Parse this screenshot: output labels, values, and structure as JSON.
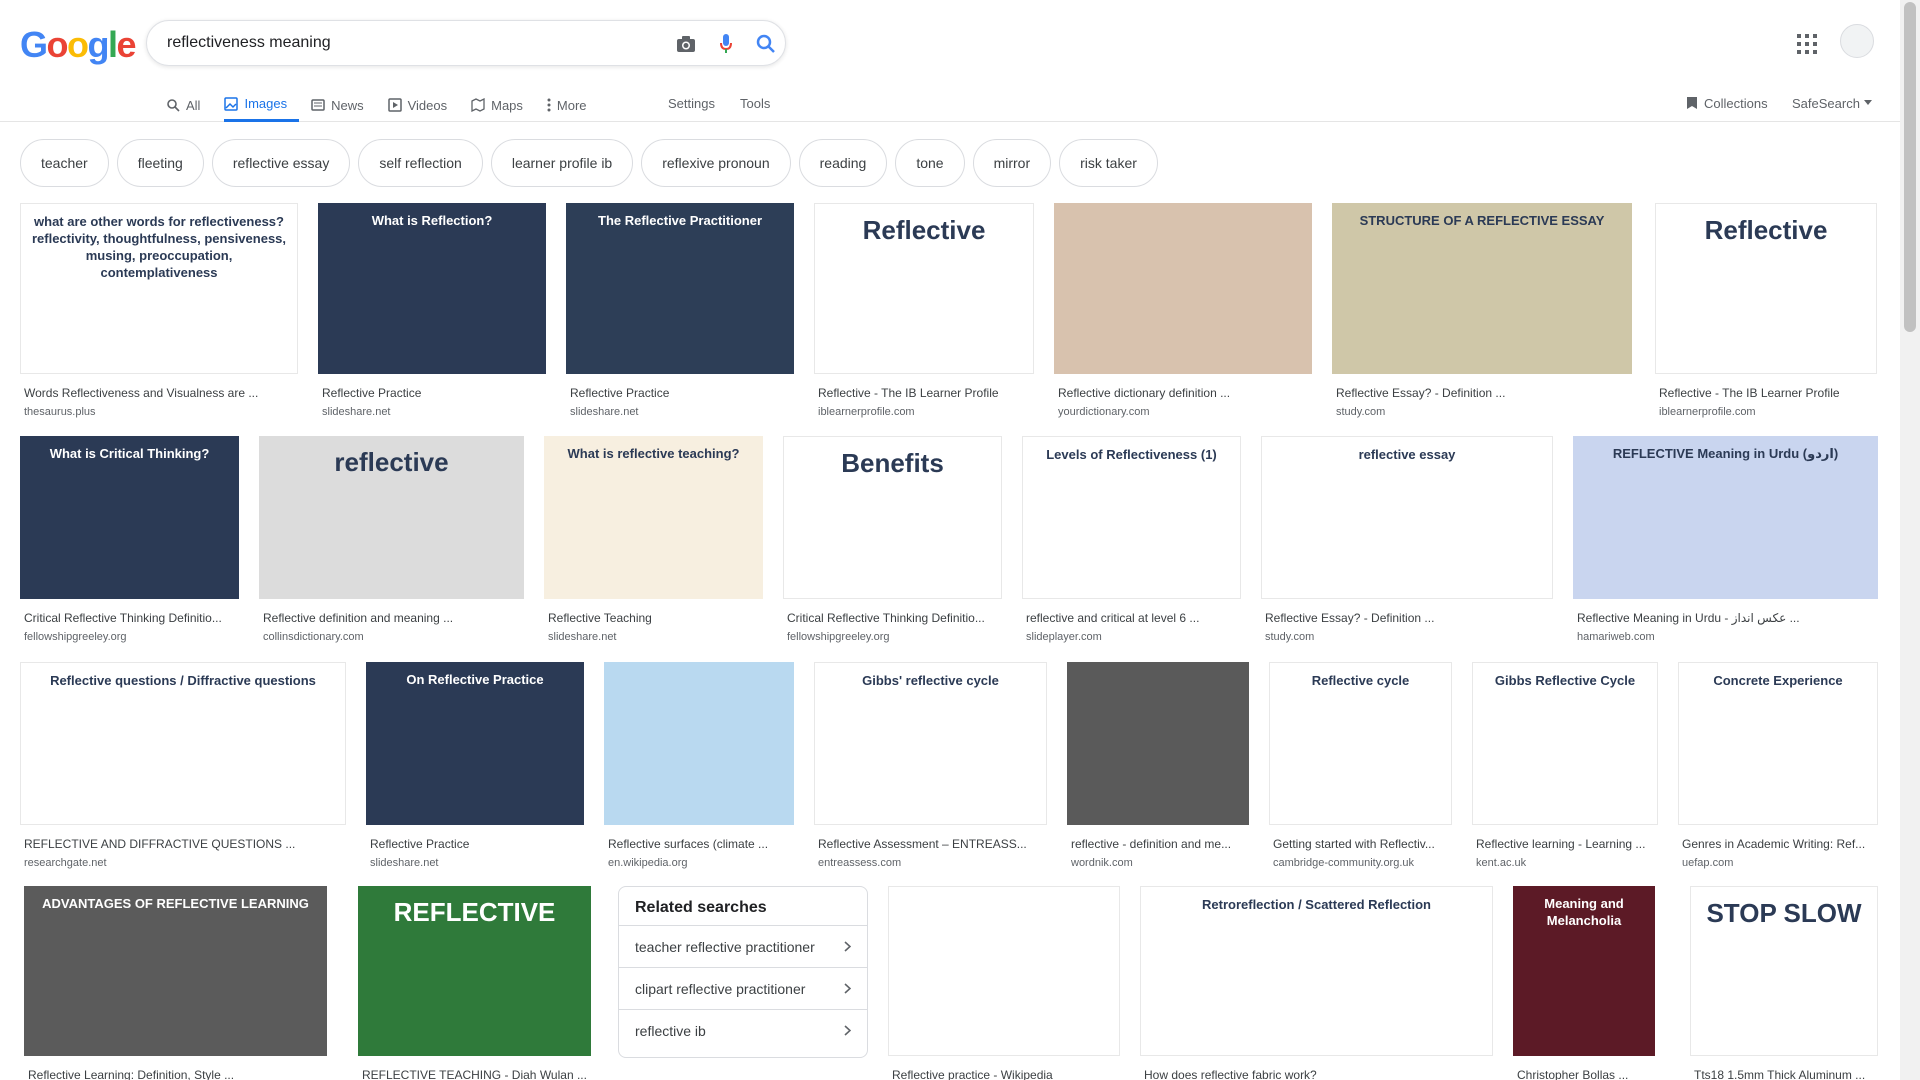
{
  "logo": [
    "G",
    "o",
    "o",
    "g",
    "l",
    "e"
  ],
  "search": {
    "value": "reflectiveness meaning"
  },
  "nav": {
    "all": "All",
    "images": "Images",
    "news": "News",
    "videos": "Videos",
    "maps": "Maps",
    "more": "More",
    "settings": "Settings",
    "tools": "Tools",
    "collections": "Collections",
    "safesearch": "SafeSearch"
  },
  "chips": [
    "teacher",
    "fleeting",
    "reflective essay",
    "self reflection",
    "learner profile ib",
    "reflexive pronoun",
    "reading",
    "tone",
    "mirror",
    "risk taker"
  ],
  "results": [
    {
      "title": "Words Reflectiveness and Visualness are ...",
      "source": "thesaurus.plus",
      "thumb_text": "what are other words for reflectiveness? reflectivity, thoughtfulness, pensiveness, musing, preoccupation, contemplativeness",
      "bg": "#ffffff"
    },
    {
      "title": "Reflective Practice",
      "source": "slideshare.net",
      "thumb_text": "What is Reflection?",
      "bg": "#2b3a55"
    },
    {
      "title": "Reflective Practice",
      "source": "slideshare.net",
      "thumb_text": "The Reflective Practitioner",
      "bg": "#2d3e57"
    },
    {
      "title": "Reflective - The IB Learner Profile",
      "source": "iblearnerprofile.com",
      "thumb_text": "Reflective",
      "bg": "#ffffff"
    },
    {
      "title": "Reflective dictionary definition ...",
      "source": "yourdictionary.com",
      "thumb_text": "",
      "bg": "#d8c2ae"
    },
    {
      "title": "Reflective Essay? - Definition ...",
      "source": "study.com",
      "thumb_text": "STRUCTURE OF A REFLECTIVE ESSAY",
      "bg": "#cfc7a8"
    },
    {
      "title": "Reflective - The IB Learner Profile",
      "source": "iblearnerprofile.com",
      "thumb_text": "Reflective",
      "bg": "#ffffff"
    },
    {
      "title": "Critical Reflective Thinking Definitio...",
      "source": "fellowshipgreeley.org",
      "thumb_text": "What is Critical Thinking?",
      "bg": "#2b3a55"
    },
    {
      "title": "Reflective definition and meaning ...",
      "source": "collinsdictionary.com",
      "thumb_text": "reflective",
      "bg": "#dcdcdc"
    },
    {
      "title": "Reflective Teaching",
      "source": "slideshare.net",
      "thumb_text": "What is reflective teaching?",
      "bg": "#f7efe0"
    },
    {
      "title": "Critical Reflective Thinking Definitio...",
      "source": "fellowshipgreeley.org",
      "thumb_text": "Benefits",
      "bg": "#ffffff"
    },
    {
      "title": "reflective and critical at level 6 ...",
      "source": "slideplayer.com",
      "thumb_text": "Levels of Reflectiveness (1)",
      "bg": "#ffffff"
    },
    {
      "title": "Reflective Essay? - Definition ...",
      "source": "study.com",
      "thumb_text": "reflective essay",
      "bg": "#ffffff"
    },
    {
      "title": "Reflective Meaning in Urdu - عکس انداز ...",
      "source": "hamariweb.com",
      "thumb_text": "REFLECTIVE Meaning in Urdu (اردو)",
      "bg": "#c9d5ef"
    },
    {
      "title": "REFLECTIVE AND DIFFRACTIVE QUESTIONS ...",
      "source": "researchgate.net",
      "thumb_text": "Reflective questions / Diffractive questions",
      "bg": "#ffffff"
    },
    {
      "title": "Reflective Practice",
      "source": "slideshare.net",
      "thumb_text": "On Reflective Practice",
      "bg": "#2b3a55"
    },
    {
      "title": "Reflective surfaces (climate ...",
      "source": "en.wikipedia.org",
      "thumb_text": "",
      "bg": "#b9d9f0"
    },
    {
      "title": "Reflective Assessment – ENTREASS...",
      "source": "entreassess.com",
      "thumb_text": "Gibbs' reflective cycle",
      "bg": "#ffffff"
    },
    {
      "title": "reflective - definition and me...",
      "source": "wordnik.com",
      "thumb_text": "",
      "bg": "#5a5a5a"
    },
    {
      "title": "Getting started with Reflectiv...",
      "source": "cambridge-community.org.uk",
      "thumb_text": "Reflective cycle",
      "bg": "#ffffff"
    },
    {
      "title": "Reflective learning - Learning ...",
      "source": "kent.ac.uk",
      "thumb_text": "Gibbs Reflective Cycle",
      "bg": "#ffffff"
    },
    {
      "title": "Genres in Academic Writing: Ref...",
      "source": "uefap.com",
      "thumb_text": "Concrete Experience",
      "bg": "#ffffff"
    },
    {
      "title": "Reflective Learning: Definition, Style ...",
      "source": "",
      "thumb_text": "ADVANTAGES OF REFLECTIVE LEARNING",
      "bg": "#5b5b5b"
    },
    {
      "title": "REFLECTIVE TEACHING - Diah Wulan ...",
      "source": "",
      "thumb_text": "REFLECTIVE",
      "bg": "#2f7a3a"
    },
    {
      "title": "Reflective practice - Wikipedia",
      "source": "",
      "thumb_text": "",
      "bg": "#ffffff"
    },
    {
      "title": "How does reflective fabric work?",
      "source": "",
      "thumb_text": "Retroreflection / Scattered Reflection",
      "bg": "#ffffff"
    },
    {
      "title": "Christopher Bollas ...",
      "source": "",
      "thumb_text": "Meaning and Melancholia",
      "bg": "#5c1a26"
    },
    {
      "title": "Tts18 1.5mm Thick Aluminum ...",
      "source": "",
      "thumb_text": "STOP SLOW",
      "bg": "#ffffff"
    }
  ],
  "related": {
    "heading": "Related searches",
    "items": [
      "teacher reflective practitioner",
      "clipart reflective practitioner",
      "reflective ib"
    ]
  },
  "colors": {
    "accent": "#1a73e8",
    "chip_border": "#dadce0"
  }
}
